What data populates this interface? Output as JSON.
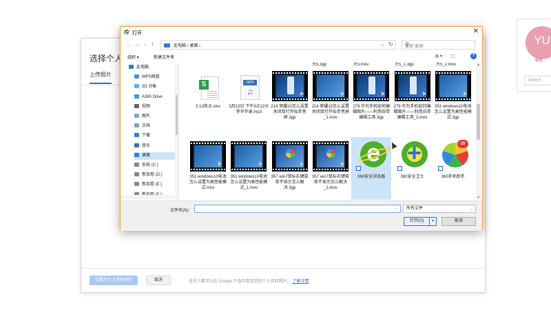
{
  "background": {
    "title": "选择个人",
    "tab": "上传照片",
    "set_button": "设置为个人资料照片",
    "cancel_button": "取消",
    "note": "任何人都可以在 Google 产品中看到您的个人资料照片。",
    "learn_more": "了解详情",
    "avatar_text": "YU",
    "avatar_sub": "就在",
    "side_input": "添加帐号"
  },
  "dialog": {
    "title": "打开",
    "breadcrumbs": "此电脑  ›  桌面  ›",
    "search_placeholder": "搜索\"桌面\"",
    "organize": "组织 ▾",
    "new_folder": "新建文件夹",
    "help": "?",
    "sidebar": [
      {
        "label": "此电脑",
        "color": "#2e7fd6"
      },
      {
        "label": "WPS网盘",
        "color": "#4a90e2"
      },
      {
        "label": "3D 对象",
        "color": "#5ab0f0"
      },
      {
        "label": "A360 Drive",
        "color": "#3a9ad9"
      },
      {
        "label": "视频",
        "color": "#666"
      },
      {
        "label": "图片",
        "color": "#7aa7d9"
      },
      {
        "label": "文档",
        "color": "#8aa0b8"
      },
      {
        "label": "下载",
        "color": "#2e7fd6"
      },
      {
        "label": "音乐",
        "color": "#3a6fb0"
      },
      {
        "label": "桌面",
        "color": "#2e7fd6",
        "selected": true
      },
      {
        "label": "系统 (C:)",
        "color": "#888"
      },
      {
        "label": "新加卷 (D:)",
        "color": "#888"
      },
      {
        "label": "新加卷 (E:)",
        "color": "#888"
      },
      {
        "label": "新加卷 (F:)",
        "color": "#888"
      },
      {
        "label": "网络",
        "color": "#3a6fb0"
      }
    ],
    "top_cutoff": [
      "大5.3gp",
      "大5.mov",
      "大5_1.3gp",
      "大5_2.mov"
    ],
    "files_row1": [
      {
        "kind": "xlsx",
        "label": "3.13热点.xlsx"
      },
      {
        "kind": "mp3",
        "label": "3月13日 下午3点12分李华华录.mp3"
      },
      {
        "kind": "video-phone",
        "label": "214 荣耀10怎么设置关闭双打开抬手亮屏.3gp"
      },
      {
        "kind": "video",
        "label": "214 荣耀10怎么设置关闭双打开抬手亮屏_1.mov"
      },
      {
        "kind": "video-phone",
        "label": "279 华为手机如何编辑图片——利用自带编辑工具.3gp"
      },
      {
        "kind": "video-phone",
        "label": "279 华为手机如何编辑图片——利用自带编辑工具_1.mov"
      },
      {
        "kind": "video",
        "label": "351 windows10电池怎么设置为高性能模式.3gp"
      }
    ],
    "files_row2": [
      {
        "kind": "video",
        "label": "351 windows10电池怎么设置为高性能模式.mov"
      },
      {
        "kind": "video",
        "label": "351 windows10电池怎么设置为高性能模式_1.mov"
      },
      {
        "kind": "video-win7",
        "label": "357 win7鼠标右键菜单不显示怎么解决.3gp"
      },
      {
        "kind": "video-win7",
        "label": "357 win7鼠标右键菜单不显示怎么解决_1.mov"
      },
      {
        "kind": "ie",
        "label": "360安全浏览器",
        "selected": true
      },
      {
        "kind": "guard",
        "label": "360安全卫士"
      },
      {
        "kind": "helper",
        "label": "360手机助手"
      }
    ],
    "filename_label": "文件名(N):",
    "filename_value": "",
    "filetype": "所有文件",
    "open_button": "打开(O)",
    "cancel_button": "取消"
  }
}
